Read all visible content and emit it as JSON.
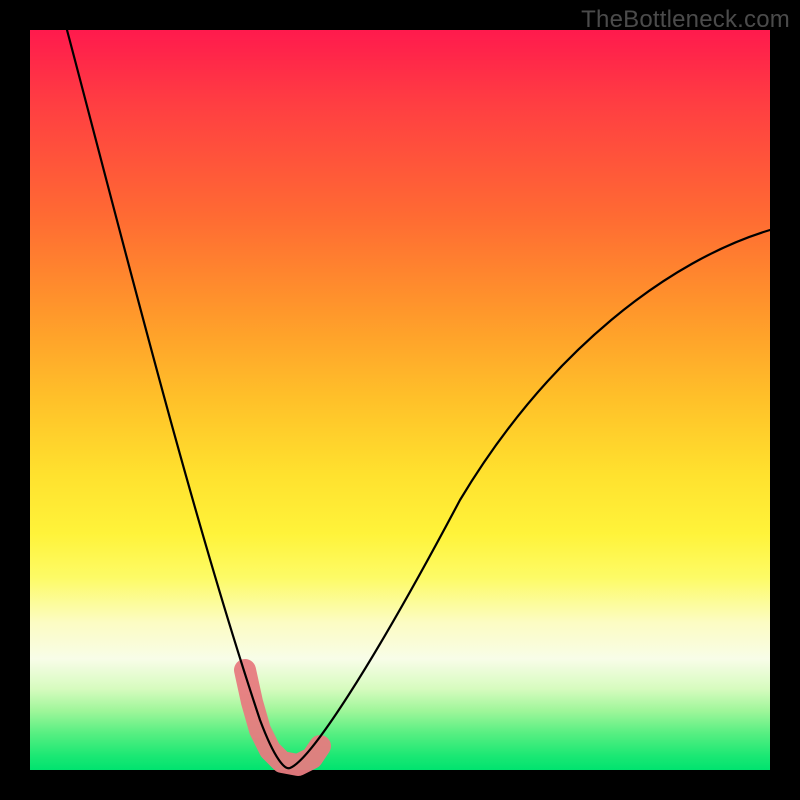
{
  "watermark": {
    "text": "TheBottleneck.com"
  },
  "chart_data": {
    "type": "line",
    "title": "",
    "xlabel": "",
    "ylabel": "",
    "xlim": [
      0,
      100
    ],
    "ylim": [
      0,
      100
    ],
    "grid": false,
    "legend": false,
    "background": "rainbow-gradient-red-to-green-vertical",
    "series": [
      {
        "name": "bottleneck-curve",
        "x": [
          5,
          10,
          15,
          20,
          25,
          28,
          30,
          32,
          33,
          34,
          36,
          40,
          45,
          50,
          55,
          60,
          70,
          80,
          90,
          100
        ],
        "values": [
          100,
          82,
          64,
          46,
          28,
          17,
          10,
          4,
          1,
          0,
          1,
          5,
          13,
          21,
          29,
          36,
          48,
          58,
          66,
          73
        ]
      }
    ],
    "annotations": [
      {
        "name": "optimal-marker",
        "type": "polyline",
        "color": "#e77b80",
        "points_x": [
          29,
          30,
          31,
          32,
          33,
          34,
          35,
          36,
          37
        ],
        "points_y": [
          13,
          8,
          4,
          2,
          1,
          0,
          0,
          1,
          3
        ]
      }
    ]
  }
}
